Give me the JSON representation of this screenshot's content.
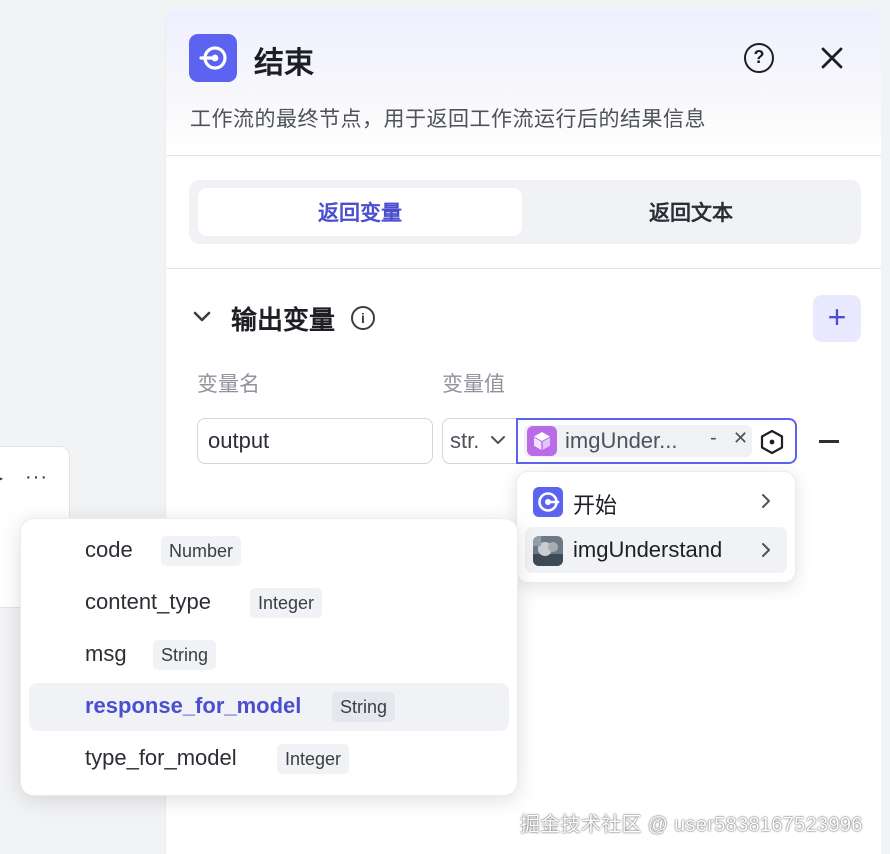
{
  "panel": {
    "title": "结束",
    "description": "工作流的最终节点，用于返回工作流运行后的结果信息",
    "icons": {
      "node": "end-node-icon",
      "help": "question-circle-icon",
      "close": "close-icon"
    },
    "accent_color": "#5b63f0"
  },
  "tabs": [
    {
      "label": "返回变量",
      "active": true
    },
    {
      "label": "返回文本",
      "active": false
    }
  ],
  "output_section": {
    "title": "输出变量",
    "columns": {
      "name": "变量名",
      "value": "变量值"
    },
    "rows": [
      {
        "name": "output",
        "type": "str.",
        "value_node": "imgUnder...",
        "value_suffix": "-",
        "remove_label": "—"
      }
    ]
  },
  "node_menu": {
    "items": [
      {
        "label": "开始",
        "icon": "start-node-icon"
      },
      {
        "label": "imgUnderstand",
        "icon": "image-thumbnail-icon",
        "selected": true
      }
    ]
  },
  "field_menu": {
    "items": [
      {
        "name": "code",
        "type": "Number"
      },
      {
        "name": "content_type",
        "type": "Integer"
      },
      {
        "name": "msg",
        "type": "String"
      },
      {
        "name": "response_for_model",
        "type": "String",
        "selected": true
      },
      {
        "name": "type_for_model",
        "type": "Integer"
      }
    ]
  },
  "watermark": "掘金技术社区 @ user5838167523996"
}
